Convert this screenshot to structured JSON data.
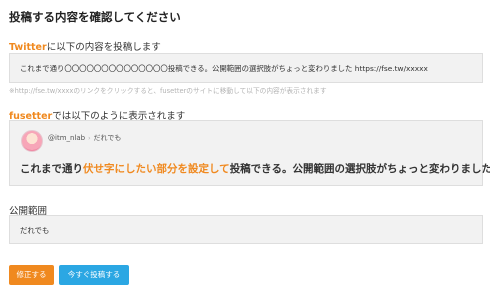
{
  "header": {
    "title": "投稿する内容を確認してください"
  },
  "twitter_section": {
    "label_accent": "Twitter",
    "label_rest": "に以下の内容を投稿します",
    "tweet_text": "これまで通り〇〇〇〇〇〇〇〇〇〇〇〇〇〇投稿できる。公開範囲の選択肢がちょっと変わりました https://fse.tw/xxxxx",
    "note": "※http://fse.tw/xxxxのリンクをクリックすると、fusetterのサイトに移動して以下の内容が表示されます"
  },
  "fusetter_section": {
    "label_accent": "fusetter",
    "label_rest": "では以下のように表示されます",
    "username": "@itm_nlab",
    "separator": "›",
    "audience": "だれでも",
    "text_before": "これまで通り",
    "text_highlight": "伏せ字にしたい部分を設定して",
    "text_after": "投稿できる。公開範囲の選択肢がちょっと変わりました"
  },
  "visibility_section": {
    "label": "公開範囲",
    "value": "だれでも"
  },
  "buttons": {
    "edit_label": "修正する",
    "post_label": "今すぐ投稿する"
  },
  "colors": {
    "accent": "#f0891f",
    "primary_button": "#2ba7e3",
    "edit_button": "#f0891f",
    "box_background": "#f2f2f2"
  }
}
